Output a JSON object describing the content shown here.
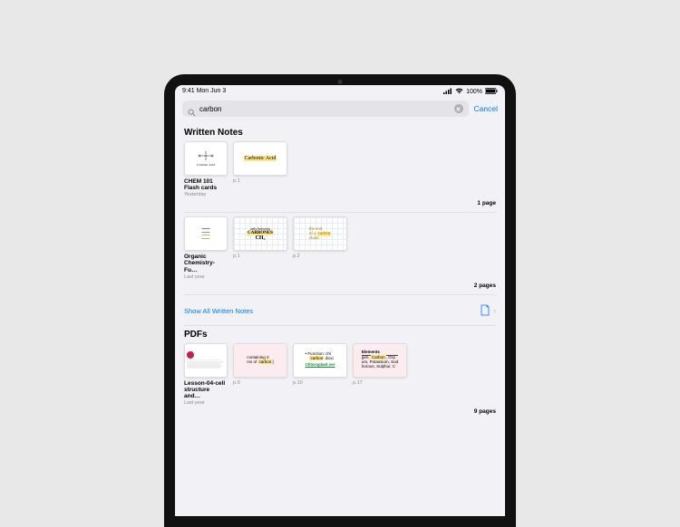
{
  "statusbar": {
    "time": "9:41",
    "date": "Mon Jun 3",
    "battery": "100%"
  },
  "search": {
    "query": "carbon",
    "cancel": "Cancel"
  },
  "sections": {
    "written": {
      "title": "Written Notes",
      "show_all": "Show All Written Notes",
      "groups": [
        {
          "title": "CHEM 101 Flash cards",
          "meta": "Yesterday",
          "pages_label": "1 page",
          "cover_text": "Carbonic Acid",
          "previews": [
            {
              "text": "Carbonic Acid",
              "page": "p.1"
            }
          ]
        },
        {
          "title": "Organic Chemistry- Fu…",
          "meta": "Last year",
          "pages_label": "2 pages",
          "cover_text": "",
          "previews": [
            {
              "text_top": "only between",
              "text_hl": "CARBONES",
              "text_bottom": "CH₃",
              "page": "p.1"
            },
            {
              "text_top": "the end",
              "text_mid": "of a",
              "text_hl": "carbon",
              "text_bottom": "chain",
              "page": "p.2"
            }
          ]
        }
      ]
    },
    "pdfs": {
      "title": "PDFs",
      "groups": [
        {
          "title": "Lesson-04-cell structure and…",
          "meta": "Last year",
          "pages_label": "9 pages",
          "previews": [
            {
              "frag1": "containing 3",
              "frag2": "ms of",
              "hl": "carbon",
              "page": "p.9"
            },
            {
              "bullet": "Function: chl",
              "hl": "carbon",
              "frag": "dioxi",
              "green": "Chloroplast ver",
              "page": "p.10"
            },
            {
              "header": "Elements",
              "line1": "gen,",
              "hl": "Carbon",
              "line1b": ", Oxy",
              "line2": "um, Potassium, Sod",
              "line3": "horous, Sulphur, C",
              "page": "p.17"
            }
          ]
        }
      ]
    }
  }
}
